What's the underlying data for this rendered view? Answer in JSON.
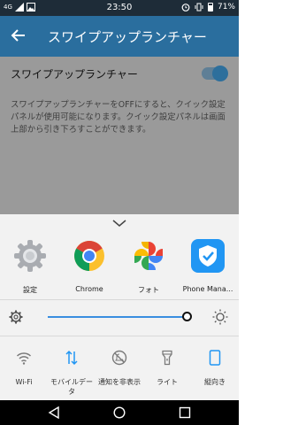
{
  "status_bar": {
    "time": "23:50",
    "network": "4G",
    "battery": "71%",
    "left_icons": [
      "signal-icon",
      "photo-icon"
    ],
    "right_icons": [
      "alarm-icon",
      "vibrate-icon",
      "battery-icon"
    ]
  },
  "app_bar": {
    "back_icon": "arrow-left-icon",
    "title": "スワイプアップランチャー"
  },
  "settings": {
    "toggle_label": "スワイプアップランチャー",
    "toggle_on": true,
    "description": "スワイプアップランチャーをOFFにすると、クイック設定パネルが使用可能になります。クイック設定パネルは画面上部から引き下ろすことができます。"
  },
  "launcher": {
    "handle_icon": "chevron-down-icon",
    "apps": [
      {
        "label": "設定",
        "icon": "settings-gear-icon"
      },
      {
        "label": "Chrome",
        "icon": "chrome-icon"
      },
      {
        "label": "フォト",
        "icon": "photos-pinwheel-icon"
      },
      {
        "label": "Phone Mana...",
        "icon": "phone-manager-shield-icon"
      }
    ],
    "brightness": {
      "level": 0.97,
      "left_icon": "settings-gear-icon",
      "right_icon": "sun-icon"
    },
    "toggles": [
      {
        "label": "Wi-Fi",
        "icon": "wifi-icon",
        "active": false
      },
      {
        "label": "モバイルデータ",
        "icon": "mobile-data-icon",
        "active": true
      },
      {
        "label": "通知を非表示",
        "icon": "do-not-disturb-icon",
        "active": false
      },
      {
        "label": "ライト",
        "icon": "flashlight-icon",
        "active": false
      },
      {
        "label": "縦向き",
        "icon": "portrait-lock-icon",
        "active": true
      }
    ]
  },
  "colors": {
    "accent": "#2196f3",
    "app_bar": "#2a6e9e",
    "status_bar": "#1e2c38",
    "panel": "#f2f2f2"
  }
}
